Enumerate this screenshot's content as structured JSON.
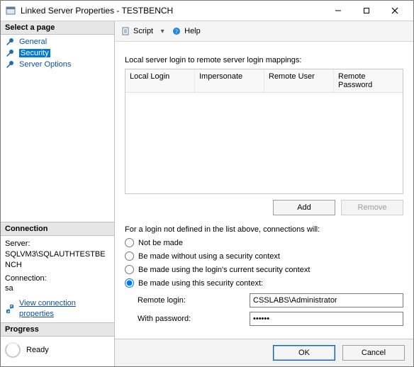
{
  "window": {
    "title": "Linked Server Properties - TESTBENCH"
  },
  "left": {
    "select_page_label": "Select a page",
    "nav": [
      {
        "label": "General",
        "selected": false
      },
      {
        "label": "Security",
        "selected": true
      },
      {
        "label": "Server Options",
        "selected": false
      }
    ],
    "connection_header": "Connection",
    "server_label": "Server:",
    "server_value": "SQLVM3\\SQLAUTHTESTBENCH",
    "connection_label": "Connection:",
    "connection_value": "sa",
    "view_conn_link": "View connection properties",
    "progress_header": "Progress",
    "progress_status": "Ready"
  },
  "toolbar": {
    "script_label": "Script",
    "help_label": "Help"
  },
  "main": {
    "mapping_intro": "Local server login to remote server login mappings:",
    "grid_columns": [
      "Local Login",
      "Impersonate",
      "Remote User",
      "Remote Password"
    ],
    "add_label": "Add",
    "remove_label": "Remove",
    "radio_intro": "For a login not defined in the list above, connections will:",
    "radios": [
      "Not be made",
      "Be made without using a security context",
      "Be made using the login's current security context",
      "Be made using this security context:"
    ],
    "selected_radio_index": 3,
    "remote_login_label": "Remote login:",
    "remote_login_value": "CSSLABS\\Administrator",
    "with_password_label": "With password:",
    "with_password_value": "••••••"
  },
  "footer": {
    "ok_label": "OK",
    "cancel_label": "Cancel"
  }
}
